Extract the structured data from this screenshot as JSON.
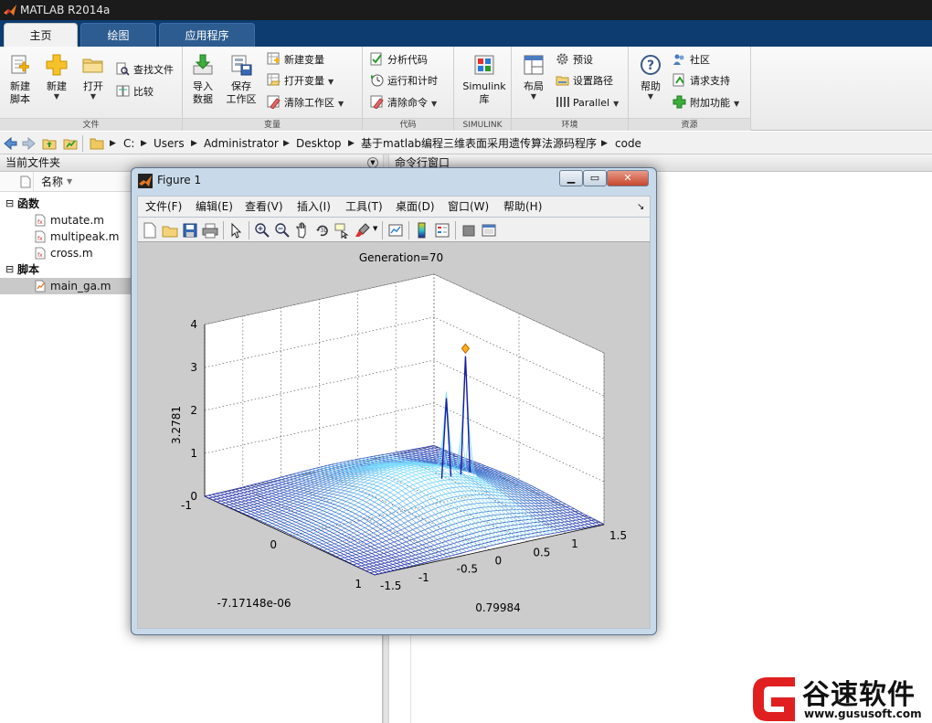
{
  "app": {
    "title": "MATLAB R2014a"
  },
  "tabs": [
    {
      "label": "主页"
    },
    {
      "label": "绘图"
    },
    {
      "label": "应用程序"
    }
  ],
  "ribbon": {
    "file": {
      "label": "文件",
      "new_script": "新建\n脚本",
      "new": "新建",
      "open": "打开",
      "find_files": "查找文件",
      "compare": "比较"
    },
    "variable": {
      "label": "变量",
      "import_data": "导入\n数据",
      "save_workspace": "保存\n工作区",
      "new_variable": "新建变量",
      "open_variable": "打开变量",
      "clear_workspace": "清除工作区"
    },
    "code": {
      "label": "代码",
      "analyze_code": "分析代码",
      "run_and_time": "运行和计时",
      "clear_commands": "清除命令"
    },
    "simulink": {
      "label": "SIMULINK",
      "library": "Simulink\n库"
    },
    "environment": {
      "label": "环境",
      "layout": "布局",
      "preferences": "预设",
      "set_path": "设置路径",
      "parallel": "Parallel"
    },
    "resources": {
      "label": "资源",
      "help": "帮助",
      "community": "社区",
      "request_support": "请求支持",
      "add_ons": "附加功能"
    }
  },
  "address": {
    "crumbs": [
      "C:",
      "Users",
      "Administrator",
      "Desktop",
      "基于matlab编程三维表面采用遗传算法源码程序",
      "code"
    ]
  },
  "current_folder": {
    "title": "当前文件夹",
    "column_name": "名称",
    "groups": [
      {
        "label": "函数",
        "files": [
          "mutate.m",
          "multipeak.m",
          "cross.m"
        ]
      },
      {
        "label": "脚本",
        "files": [
          "main_ga.m"
        ]
      }
    ],
    "selected_file": "main_ga.m"
  },
  "command_window": {
    "title": "命令行窗口"
  },
  "figure": {
    "title": "Figure 1",
    "menus": [
      "文件(F)",
      "编辑(E)",
      "查看(V)",
      "插入(I)",
      "工具(T)",
      "桌面(D)",
      "窗口(W)",
      "帮助(H)"
    ],
    "toolbar_icons": [
      "new-figure-icon",
      "open-icon",
      "save-icon",
      "print-icon",
      "edit-plot-icon",
      "zoom-in-icon",
      "zoom-out-icon",
      "pan-icon",
      "rotate-3d-icon",
      "data-cursor-icon",
      "brush-icon",
      "link-plot-icon",
      "insert-colorbar-icon",
      "insert-legend-icon",
      "hide-plot-tools-icon",
      "show-plot-tools-icon"
    ]
  },
  "chart_data": {
    "type": "surface-3d",
    "title": "Generation=70",
    "xlabel": "-7.17148e-06",
    "ylabel": "0.79984",
    "zlabel": "3.2781",
    "x_ticks": [
      "-1",
      "0",
      "1"
    ],
    "y_ticks": [
      "-1.5",
      "-1",
      "-0.5",
      "0",
      "0.5",
      "1",
      "1.5"
    ],
    "z_ticks": [
      "0",
      "1",
      "2",
      "3",
      "4"
    ],
    "xlim": [
      -1,
      1
    ],
    "ylim": [
      -1.5,
      1.5
    ],
    "zlim": [
      0,
      4
    ],
    "grid": true,
    "base_peak_height": 0.85,
    "sharp_peaks": [
      {
        "x": 0.0,
        "y": 0.8,
        "z": 3.28
      },
      {
        "x": 0.0,
        "y": 0.55,
        "z": 2.4
      }
    ],
    "best_point": {
      "x": -7.17148e-06,
      "y": 0.79984,
      "z": 3.2781
    },
    "colors": {
      "surface_low": "#1a1aa0",
      "surface_high": "#7fe0ff",
      "marker": "#ffb020",
      "axes_bg": "#ffffff",
      "figure_bg": "#cccccc"
    }
  },
  "watermark": {
    "brand": "谷速软件",
    "url": "www.gususoft.com",
    "color": "#e02020"
  }
}
